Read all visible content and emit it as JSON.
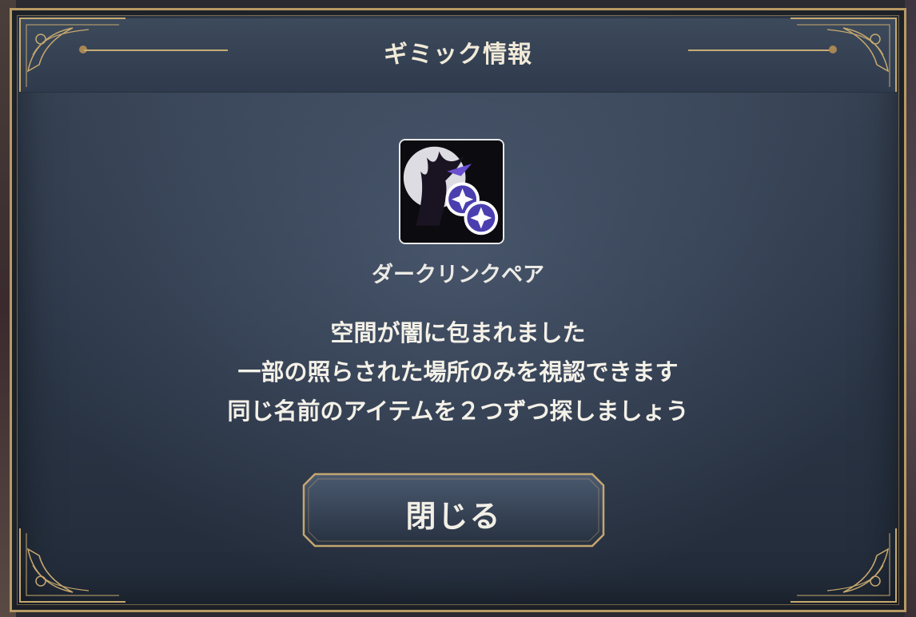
{
  "dialog": {
    "title": "ギミック情報",
    "gimmick": {
      "icon": "dark-link-pair-icon",
      "name": "ダークリンクペア"
    },
    "description_lines": [
      "空間が闇に包まれました",
      "一部の照らされた場所のみを視認できます",
      "同じ名前のアイテムを２つずつ探しましょう"
    ],
    "close_label": "閉じる"
  },
  "colors": {
    "gold_trim": "#b89a62",
    "panel_top": "#3a4658",
    "panel_bottom": "#222b39",
    "text": "#f4f1e8",
    "icon_purple": "#4b3fb0"
  }
}
